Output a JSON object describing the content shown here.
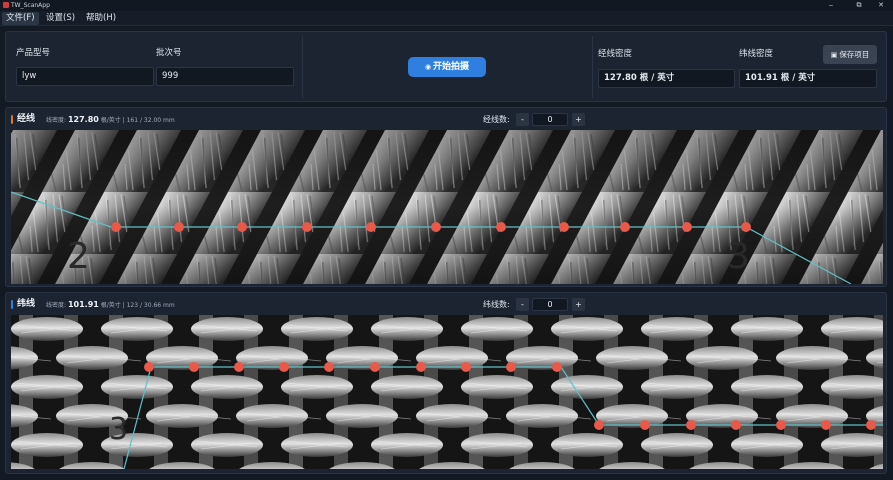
{
  "window": {
    "title": "TW_ScanApp",
    "minimize": "‒",
    "maximize": "⧉",
    "close": "✕"
  },
  "menu": [
    {
      "label": "文件(F)"
    },
    {
      "label": "设置(S)"
    },
    {
      "label": "帮助(H)"
    }
  ],
  "top": {
    "product_label": "产品型号",
    "product_value": "lyw",
    "batch_label": "批次号",
    "batch_value": "999",
    "start_button": "开始拍摄",
    "warp_density_label": "经线密度",
    "warp_density_value": "127.80 根 / 英寸",
    "weft_density_label": "纬线密度",
    "weft_density_value": "101.91 根 / 英寸",
    "save_button": "保存项目"
  },
  "warp": {
    "title": "经线",
    "meta_prefix": "线密度:",
    "meta_value": "127.80",
    "meta_suffix": "根/英寸 | 161 / 32.00 mm",
    "count_label": "经线数:",
    "count_value": "0",
    "minus": "-",
    "plus": "+",
    "accent": "#e0752b",
    "digit_left": "2",
    "digit_right": "3"
  },
  "weft": {
    "title": "纬线",
    "meta_prefix": "线密度:",
    "meta_value": "101.91",
    "meta_suffix": "根/英寸 | 123 / 30.66 mm",
    "count_label": "纬线数:",
    "count_value": "0",
    "minus": "-",
    "plus": "+",
    "accent": "#2f7fe0",
    "digit_left": "3"
  },
  "colors": {
    "marker": "#e8594a",
    "guide": "#5fc0c6",
    "accent_blue": "#2f7fe0"
  }
}
